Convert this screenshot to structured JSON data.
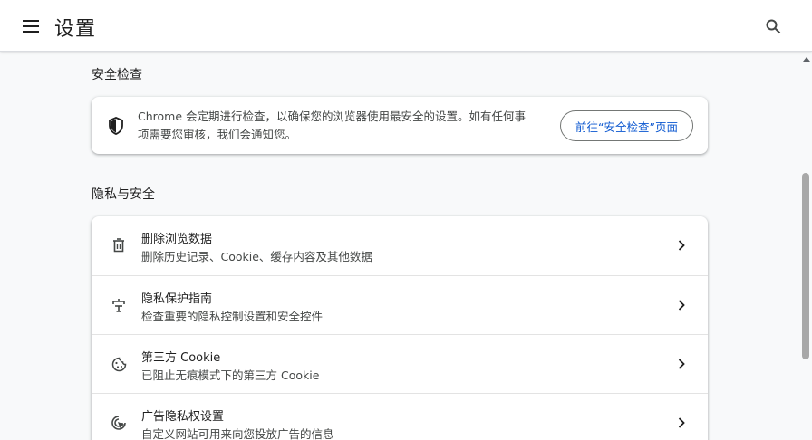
{
  "header": {
    "title": "设置"
  },
  "safety_check": {
    "section_title": "安全检查",
    "description": "Chrome 会定期进行检查，以确保您的浏览器使用最安全的设置。如有任何事项需要您审核，我们会通知您。",
    "button_label": "前往“安全检查”页面"
  },
  "privacy": {
    "section_title": "隐私与安全",
    "items": [
      {
        "label": "删除浏览数据",
        "sub": "删除历史记录、Cookie、缓存内容及其他数据",
        "icon": "trash-icon"
      },
      {
        "label": "隐私保护指南",
        "sub": "检查重要的隐私控制设置和安全控件",
        "icon": "privacy-guide-icon"
      },
      {
        "label": "第三方 Cookie",
        "sub": "已阻止无痕模式下的第三方 Cookie",
        "icon": "cookie-icon"
      },
      {
        "label": "广告隐私权设置",
        "sub": "自定义网站可用来向您投放广告的信息",
        "icon": "ad-privacy-icon"
      }
    ]
  },
  "colors": {
    "accent": "#0b57d0",
    "background": "#f8f9fa",
    "card": "#ffffff"
  }
}
